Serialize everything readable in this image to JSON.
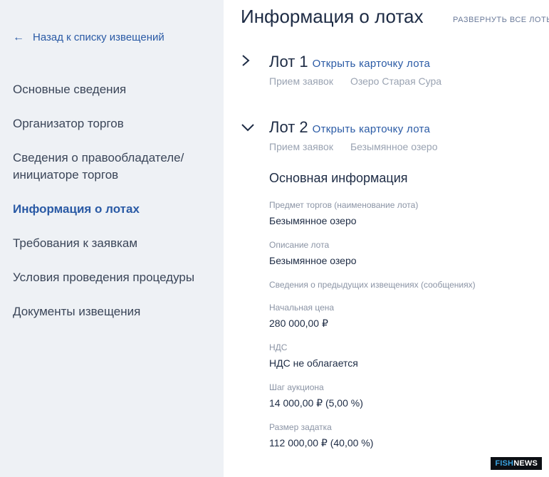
{
  "sidebar": {
    "back_label": "Назад к списку извещений",
    "items": [
      {
        "label": "Основные сведения"
      },
      {
        "label": "Организатор торгов"
      },
      {
        "label": "Сведения о правообладателе/ инициаторе торгов"
      },
      {
        "label": "Информация о лотах",
        "active": true
      },
      {
        "label": "Требования к заявкам"
      },
      {
        "label": "Условия проведения процедуры"
      },
      {
        "label": "Документы извещения"
      }
    ]
  },
  "main": {
    "title": "Информация о лотах",
    "expand_all_label": "РАЗВЕРНУТЬ ВСЕ ЛОТЫ",
    "lots": [
      {
        "title": "Лот 1",
        "card_link": "Открыть карточку лота",
        "status": "Прием заявок",
        "name": "Озеро Старая Сура",
        "expanded": false
      },
      {
        "title": "Лот 2",
        "card_link": "Открыть карточку лота",
        "status": "Прием заявок",
        "name": "Безымянное озеро",
        "expanded": true
      }
    ],
    "details": {
      "section_title": "Основная информация",
      "fields": [
        {
          "label": "Предмет торгов (наименование лота)",
          "value": "Безымянное озеро"
        },
        {
          "label": "Описание лота",
          "value": "Безымянное озеро"
        },
        {
          "label": "Сведения о предыдущих извещениях (сообщениях)",
          "value": ""
        },
        {
          "label": "Начальная цена",
          "value": "280 000,00 ₽"
        },
        {
          "label": "НДС",
          "value": "НДС не облагается"
        },
        {
          "label": "Шаг аукциона",
          "value": "14 000,00 ₽  (5,00 %)"
        },
        {
          "label": "Размер задатка",
          "value": "112 000,00 ₽  (40,00 %)"
        }
      ]
    }
  },
  "watermark": {
    "part1": "FISH",
    "part2": "NEWS"
  },
  "colors": {
    "accent": "#2a5aa5",
    "sidebar_bg": "#eef1f5",
    "text": "#1d2b44",
    "muted": "#9aa3b2"
  }
}
